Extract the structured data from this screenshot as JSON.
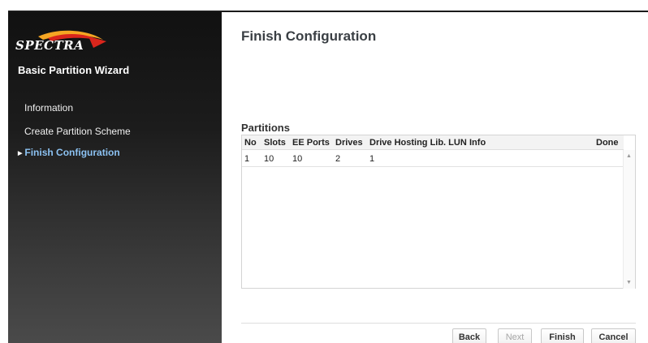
{
  "sidebar": {
    "logo_text": "SPECTRA",
    "wizard_title": "Basic Partition Wizard",
    "items": [
      {
        "label": "Information"
      },
      {
        "label": "Create Partition Scheme"
      },
      {
        "label": "Finish Configuration"
      }
    ]
  },
  "main": {
    "title": "Finish Configuration",
    "section_title": "Partitions",
    "table": {
      "columns": [
        "No",
        "Slots",
        "EE Ports",
        "Drives",
        "Drive Hosting Lib. LUN",
        "Info",
        "Done"
      ],
      "rows": [
        [
          "1",
          "10",
          "10",
          "2",
          "1",
          "",
          ""
        ]
      ]
    }
  },
  "buttons": {
    "back": "Back",
    "next": "Next",
    "finish": "Finish",
    "cancel": "Cancel"
  },
  "colors": {
    "active_nav": "#8cc2f2",
    "logo_swoosh": "#f5a623"
  }
}
